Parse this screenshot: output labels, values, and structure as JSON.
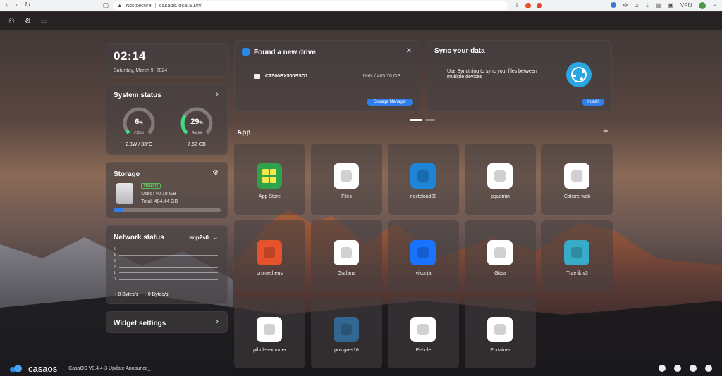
{
  "browser": {
    "security_label": "Not secure",
    "url": "casaos.local:81/#/",
    "vpn_label": "VPN"
  },
  "clock": {
    "time": "02:14",
    "date": "Saturday, March 9, 2024"
  },
  "system_status": {
    "title": "System status",
    "cpu": {
      "percent": "6",
      "unit": "%",
      "label": "CPU",
      "detail": "2.3W / 33°C",
      "fraction": 0.06
    },
    "ram": {
      "percent": "29",
      "unit": "%",
      "label": "RAM",
      "detail": "7.62 GB",
      "fraction": 0.29
    }
  },
  "storage": {
    "title": "Storage",
    "health": "Healthy",
    "used": "Used: 40.18 GB",
    "total": "Total: 484.44 GB",
    "fraction": 0.083
  },
  "network": {
    "title": "Network status",
    "interface": "enp2s0",
    "y_ticks": [
      "5",
      "4",
      "3",
      "2",
      "1",
      "0"
    ],
    "upload": "0 Bytes/s",
    "download": "0 Bytes/s"
  },
  "widget_settings": {
    "title": "Widget settings"
  },
  "drive_card": {
    "title": "Found a new drive",
    "drive_name": "CT500BX500SSD1",
    "drive_size": "NaN / 465.76 GB",
    "button": "Storage Manager"
  },
  "sync_card": {
    "title": "Sync your data",
    "description": "Use Syncthing to sync your files between multiple devices",
    "button": "Install"
  },
  "apps_section": {
    "title": "App",
    "add": "+"
  },
  "apps": [
    {
      "name": "App Store",
      "color": "#2fa34a"
    },
    {
      "name": "Files",
      "color": "#ffffff"
    },
    {
      "name": "nextcloud28",
      "color": "#1e84d6"
    },
    {
      "name": "pgadmin",
      "color": "#ffffff"
    },
    {
      "name": "Calibre-web",
      "color": "#ffffff"
    },
    {
      "name": "prometheus",
      "color": "#e6522c"
    },
    {
      "name": "Grafana",
      "color": "#ffffff"
    },
    {
      "name": "vikunja",
      "color": "#1973ff"
    },
    {
      "name": "Gitea",
      "color": "#ffffff"
    },
    {
      "name": "Traefik v3",
      "color": "#37abc8"
    },
    {
      "name": "pihole-exporter",
      "color": "#ffffff"
    },
    {
      "name": "postgres16",
      "color": "#336791"
    },
    {
      "name": "Pi-hole",
      "color": "#ffffff"
    },
    {
      "name": "Portainer",
      "color": "#ffffff"
    }
  ],
  "footer": {
    "logo": "casaos",
    "announcement": "CasaOS V0.4.4-3 Update Announce_"
  }
}
